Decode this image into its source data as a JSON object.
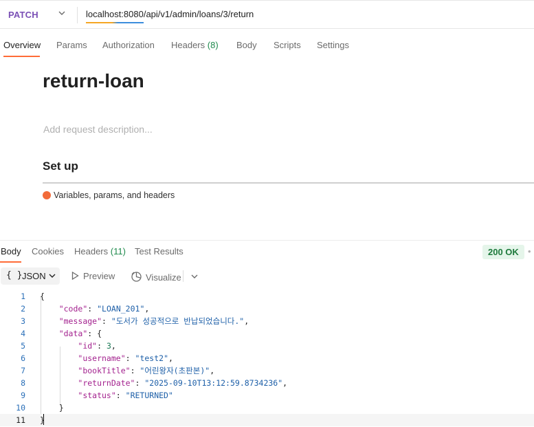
{
  "request": {
    "method": "PATCH",
    "url": "localhost:8080/api/v1/admin/loans/3/return",
    "tabs": {
      "overview": "Overview",
      "params": "Params",
      "authorization": "Authorization",
      "headers": "Headers",
      "headers_count": "(8)",
      "body": "Body",
      "scripts": "Scripts",
      "settings": "Settings"
    },
    "active_tab": "Overview",
    "name": "return-loan",
    "description_placeholder": "Add request description...",
    "setup_heading": "Set up",
    "setup_item": "Variables, params, and headers"
  },
  "response": {
    "tabs": {
      "body": "Body",
      "cookies": "Cookies",
      "headers": "Headers",
      "headers_count": "(11)",
      "test_results": "Test Results"
    },
    "status": "200 OK",
    "format": "JSON",
    "format_icon": "{ }",
    "preview_label": "Preview",
    "visualize_label": "Visualize",
    "line_numbers": [
      "1",
      "2",
      "3",
      "4",
      "5",
      "6",
      "7",
      "8",
      "9",
      "10",
      "11"
    ],
    "body_json": {
      "code": "LOAN_201",
      "message": "도서가 성공적으로 반납되었습니다.",
      "data": {
        "id": 3,
        "username": "test2",
        "bookTitle": "어린왕자(초판본)",
        "returnDate": "2025-09-10T13:12:59.8734236",
        "status": "RETURNED"
      }
    }
  },
  "colors": {
    "accent": "#ff6c37",
    "method": "#7a4fb5",
    "status_bg": "#e5f5ea",
    "status_text": "#1e7a3c"
  }
}
